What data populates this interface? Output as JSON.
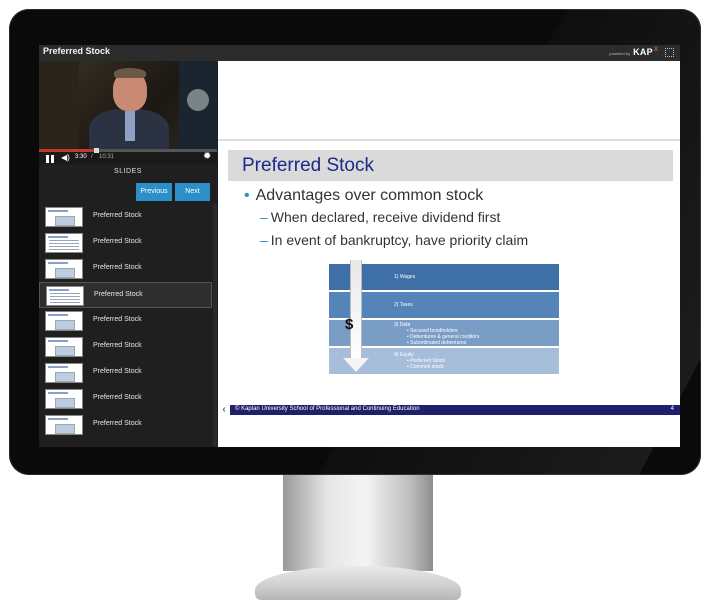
{
  "player": {
    "title": "Preferred Stock",
    "brand_small": "powered by",
    "brand_logo": "KAP",
    "brand_logo_x": "X"
  },
  "video": {
    "time_current": "3:30",
    "time_separator": "/",
    "time_total": "10:31",
    "progress_fraction": 0.32
  },
  "slides_panel": {
    "header": "SLIDES",
    "previous_label": "Previous",
    "next_label": "Next",
    "items": [
      {
        "label": "Preferred Stock",
        "active": false
      },
      {
        "label": "Preferred Stock",
        "active": false
      },
      {
        "label": "Preferred Stock",
        "active": false
      },
      {
        "label": "Preferred Stock",
        "active": true
      },
      {
        "label": "Preferred Stock",
        "active": false
      },
      {
        "label": "Preferred Stock",
        "active": false
      },
      {
        "label": "Preferred Stock",
        "active": false
      },
      {
        "label": "Preferred Stock",
        "active": false
      },
      {
        "label": "Preferred Stock",
        "active": false
      }
    ]
  },
  "slide": {
    "title": "Preferred Stock",
    "bullet": "Advantages over common stock",
    "subbullets": [
      "When declared, receive dividend first",
      "In event of bankruptcy, have priority claim"
    ],
    "diagram": {
      "symbol": "$",
      "tiers": [
        {
          "lines": [
            "1)  Wages"
          ],
          "color": "#3e6fa6"
        },
        {
          "lines": [
            "2)  Taxes"
          ],
          "color": "#5584b9"
        },
        {
          "lines": [
            "3)  Debt",
            "• Secured bondholders",
            "• Debentures & general creditors",
            "• Subordinated debentures"
          ],
          "color": "#7a9dc6"
        },
        {
          "lines": [
            "4)  Equity",
            "• Preferred Stock",
            "• Common stock"
          ],
          "color": "#a7bedb"
        }
      ]
    },
    "footer_text": "© Kaplan University School of Professional and Continuing Education",
    "page_number": "4"
  },
  "colors": {
    "accent_button": "#2d8fca",
    "slide_title": "#1c2a8a",
    "footer": "#1f1f6b"
  }
}
